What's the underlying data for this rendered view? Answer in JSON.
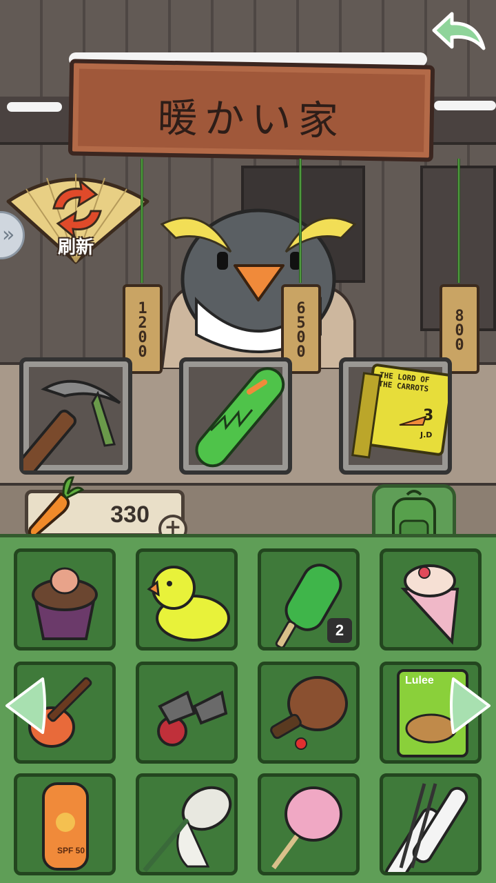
{
  "shop": {
    "title": "暖かい家",
    "refresh_label": "刷新",
    "items": [
      {
        "name": "pickaxe",
        "price": "1200"
      },
      {
        "name": "snowboard",
        "price": "6500"
      },
      {
        "name": "book-lord-of-the-carrots",
        "price": "800",
        "book_text": "THE LORD OF THE CARROTS",
        "book_volume": "3",
        "book_author": "J.D"
      }
    ]
  },
  "currency": {
    "icon": "carrot-icon",
    "value": "330",
    "add_label": "+"
  },
  "inventory": {
    "items": [
      {
        "name": "cupcake"
      },
      {
        "name": "rubber-duck"
      },
      {
        "name": "popsicle",
        "count": "2"
      },
      {
        "name": "crepe"
      },
      {
        "name": "ukulele"
      },
      {
        "name": "kendama-set"
      },
      {
        "name": "wooden-paddle"
      },
      {
        "name": "snack-bag",
        "label": "Lulee"
      },
      {
        "name": "sunscreen",
        "label": "SPF 50"
      },
      {
        "name": "bug-net"
      },
      {
        "name": "cotton-candy"
      },
      {
        "name": "skis"
      }
    ]
  },
  "colors": {
    "panel": "#5f9e57",
    "slot": "#3f7a3a",
    "sign": "#a0583a",
    "tag": "#c9a464"
  }
}
